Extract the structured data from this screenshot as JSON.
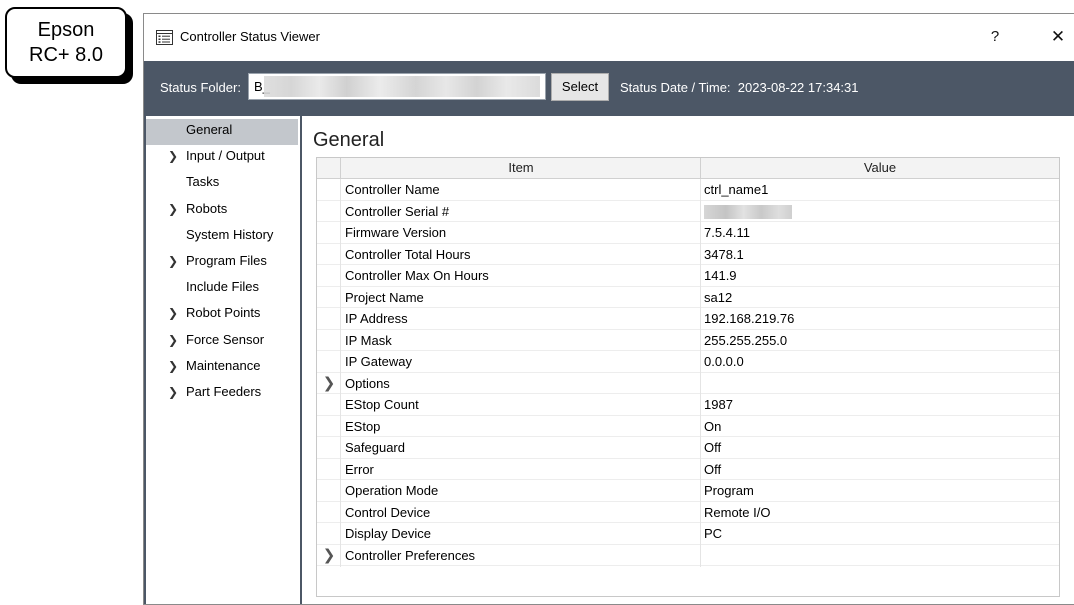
{
  "badge": {
    "line1": "Epson",
    "line2": "RC+ 8.0"
  },
  "window": {
    "title": "Controller Status Viewer",
    "help": "?",
    "close": "✕"
  },
  "topbar": {
    "folder_label": "Status Folder:",
    "folder_value": "B_",
    "select_label": "Select",
    "date_label": "Status Date / Time:",
    "date_value": "2023-08-22 17:34:31"
  },
  "sidebar": {
    "items": [
      {
        "label": "General",
        "expandable": false,
        "selected": true
      },
      {
        "label": "Input / Output",
        "expandable": true
      },
      {
        "label": "Tasks",
        "expandable": false
      },
      {
        "label": "Robots",
        "expandable": true
      },
      {
        "label": "System History",
        "expandable": false
      },
      {
        "label": "Program Files",
        "expandable": true
      },
      {
        "label": "Include Files",
        "expandable": false
      },
      {
        "label": "Robot Points",
        "expandable": true
      },
      {
        "label": "Force Sensor",
        "expandable": true
      },
      {
        "label": "Maintenance",
        "expandable": true
      },
      {
        "label": "Part Feeders",
        "expandable": true
      }
    ]
  },
  "main": {
    "title": "General",
    "columns": {
      "item": "Item",
      "value": "Value"
    },
    "rows": [
      {
        "item": "Controller Name",
        "value": "ctrl_name1"
      },
      {
        "item": "Controller Serial #",
        "value": "",
        "redacted": true
      },
      {
        "item": "Firmware Version",
        "value": "7.5.4.11"
      },
      {
        "item": "Controller Total Hours",
        "value": "3478.1"
      },
      {
        "item": "Controller Max On Hours",
        "value": "141.9"
      },
      {
        "item": "Project Name",
        "value": "sa12"
      },
      {
        "item": "IP Address",
        "value": "192.168.219.76"
      },
      {
        "item": "IP Mask",
        "value": "255.255.255.0"
      },
      {
        "item": "IP Gateway",
        "value": "0.0.0.0"
      },
      {
        "item": "Options",
        "value": "",
        "expandable": true
      },
      {
        "item": "EStop Count",
        "value": "1987"
      },
      {
        "item": "EStop",
        "value": "On"
      },
      {
        "item": "Safeguard",
        "value": "Off"
      },
      {
        "item": "Error",
        "value": "Off"
      },
      {
        "item": "Operation Mode",
        "value": "Program"
      },
      {
        "item": "Control Device",
        "value": "Remote I/O"
      },
      {
        "item": "Display Device",
        "value": "PC"
      },
      {
        "item": "Controller Preferences",
        "value": "",
        "expandable": true
      }
    ]
  },
  "icons": {
    "title_icon": "list-window-icon",
    "expand_icon": "chevron-right-icon"
  },
  "colors": {
    "toolbar_bg": "#4c5766",
    "selected_item_bg": "#c3c7cc"
  }
}
